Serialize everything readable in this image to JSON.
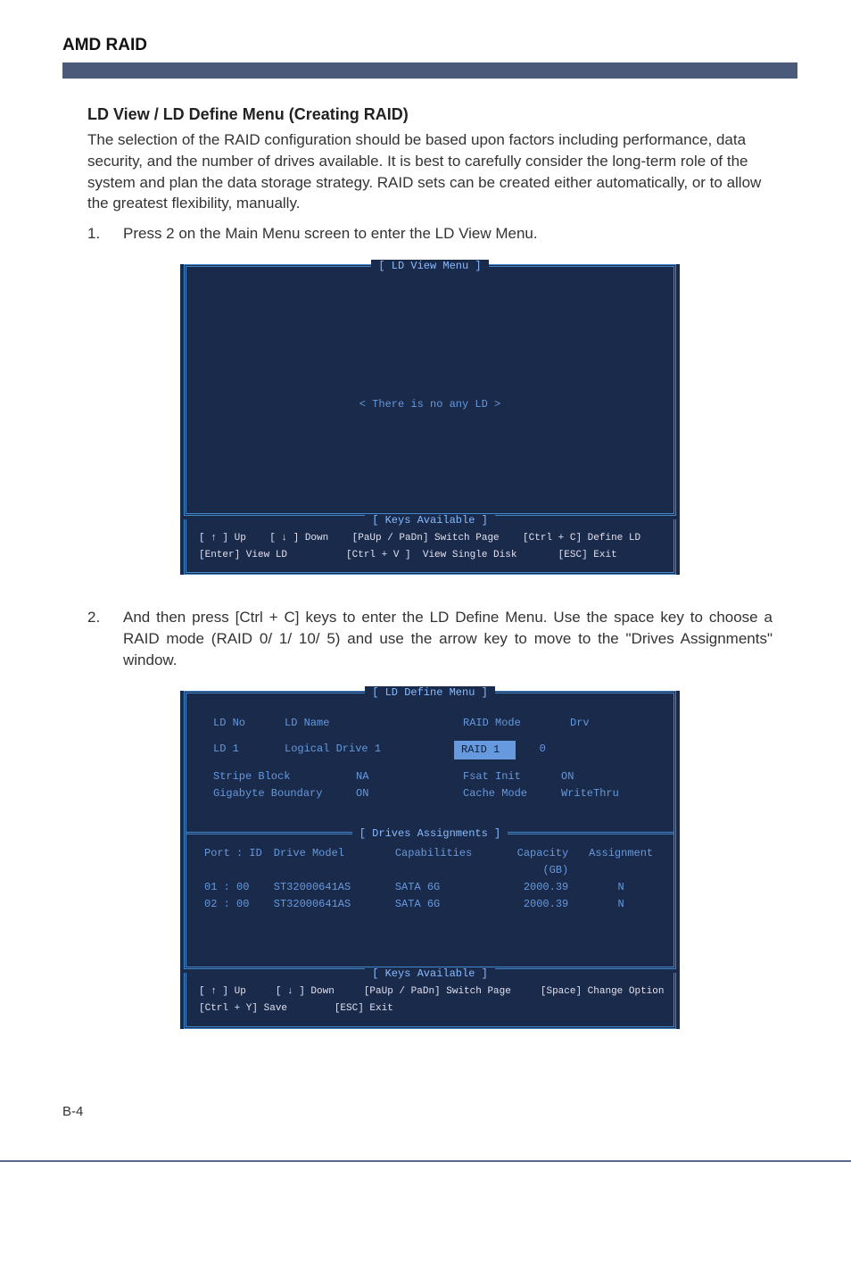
{
  "doc_title": "AMD RAID",
  "section_title": "LD View / LD Define Menu (Creating RAID)",
  "intro_para": "The selection of the RAID configuration should be based upon factors including performance, data security, and the number of drives available. It is best to carefully consider the long-term role of the system and plan the data storage strategy. RAID sets can be created either automatically, or to allow the greatest flexibility, manually.",
  "steps": [
    {
      "num": "1.",
      "text": "Press 2 on the Main Menu screen to enter the LD View Menu."
    },
    {
      "num": "2.",
      "text": "And then press [Ctrl + C] keys to enter the LD Define Menu. Use the space key to choose a RAID mode (RAID 0/ 1/ 10/ 5) and use the arrow key to move to the \"Drives Assignments\" window."
    }
  ],
  "bios1": {
    "title": "[  LD View Menu  ]",
    "no_ld": "<  There is no any LD  >",
    "keys_title": "[  Keys Available  ]",
    "keys1": "[ ↑ ] Up    [ ↓ ] Down    [PaUp / PaDn] Switch Page    [Ctrl + C] Define LD",
    "keys2": "[Enter] View LD          [Ctrl + V ]  View Single Disk       [ESC] Exit"
  },
  "bios2": {
    "title": "[  LD Define Menu  ]",
    "hdr": {
      "ldno": "LD No",
      "ldname": "LD Name",
      "raid": "RAID Mode",
      "drv": "Drv"
    },
    "row": {
      "ld": "LD   1",
      "name": "Logical Drive 1",
      "raid": "RAID 1",
      "drv": "0"
    },
    "opt1": {
      "stripe": "Stripe Block",
      "sv": "NA",
      "fsat": "Fsat Init",
      "fv": "ON"
    },
    "opt2": {
      "gb": "Gigabyte Boundary",
      "gv": "ON",
      "cm": "Cache Mode",
      "cv": "WriteThru"
    },
    "drv_title": "[  Drives Assignments  ]",
    "dhdr": {
      "port": "Port : ID",
      "model": "Drive Model",
      "cap": "Capabilities",
      "gb": "Capacity (GB)",
      "asg": "Assignment"
    },
    "drows": [
      {
        "port": "01 : 00",
        "model": "ST32000641AS",
        "cap": "SATA 6G",
        "gb": "2000.39",
        "asg": "N"
      },
      {
        "port": "02 : 00",
        "model": "ST32000641AS",
        "cap": "SATA 6G",
        "gb": "2000.39",
        "asg": "N"
      }
    ],
    "keys_title": "[  Keys Available  ]",
    "keys1": "[ ↑ ] Up     [ ↓ ] Down     [PaUp / PaDn] Switch Page     [Space] Change Option",
    "keys2": "[Ctrl + Y] Save        [ESC] Exit"
  },
  "page_num": "B-4"
}
